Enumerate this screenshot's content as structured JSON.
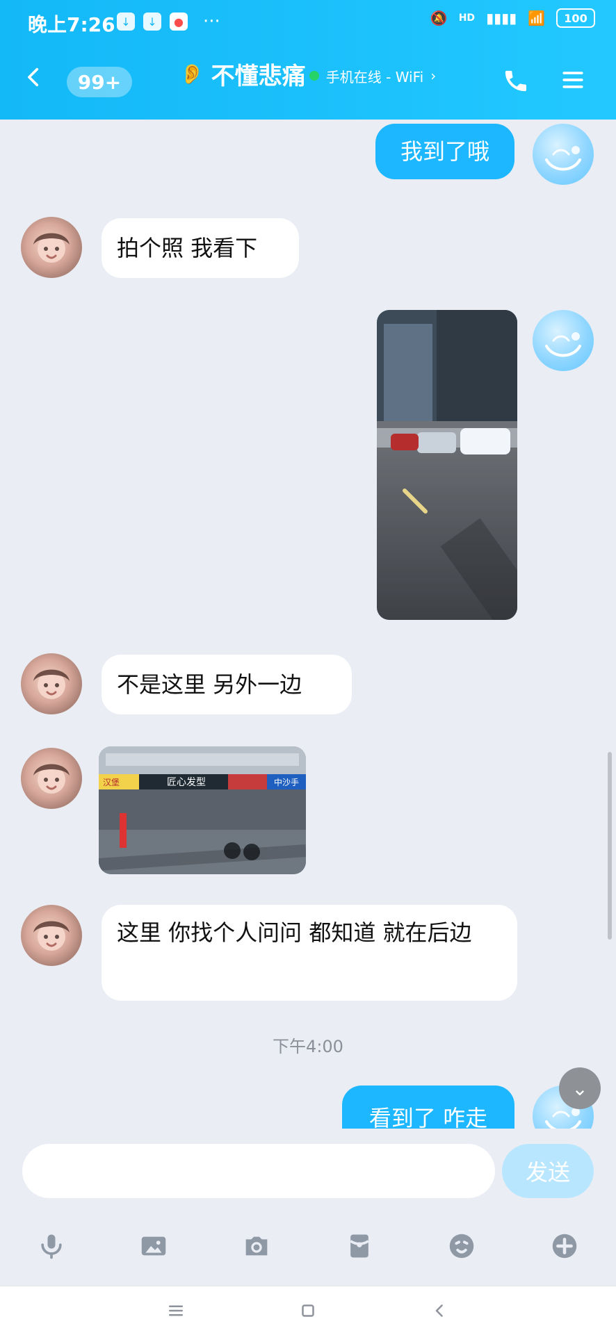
{
  "status_bar": {
    "time": "晚上7:26",
    "more": "···",
    "battery": "100",
    "hd": "HD"
  },
  "header": {
    "unread_badge": "99+",
    "contact_name": "不懂悲痛",
    "status": "手机在线 - WiFi"
  },
  "messages": [
    {
      "side": "me",
      "type": "text",
      "text": "我到了哦"
    },
    {
      "side": "other",
      "type": "text",
      "text": "拍个照 我看下"
    },
    {
      "side": "me",
      "type": "image"
    },
    {
      "side": "other",
      "type": "text",
      "text": "不是这里 另外一边"
    },
    {
      "side": "other",
      "type": "image",
      "sign_texts": [
        "汉堡",
        "匠心发型",
        "中沙手"
      ]
    },
    {
      "side": "other",
      "type": "text",
      "text": "这里 你找个人问问 都知道 就在后边"
    },
    {
      "type": "timestamp",
      "text": "下午4:00"
    },
    {
      "side": "me",
      "type": "text",
      "text": "看到了 咋走"
    }
  ],
  "input": {
    "placeholder": "",
    "value": "",
    "send_label": "发送"
  },
  "tools": [
    {
      "icon": "microphone-icon"
    },
    {
      "icon": "image-icon"
    },
    {
      "icon": "camera-icon"
    },
    {
      "icon": "red-packet-icon"
    },
    {
      "icon": "emoji-icon"
    },
    {
      "icon": "plus-icon"
    }
  ],
  "nav": [
    {
      "icon": "menu-icon"
    },
    {
      "icon": "home-icon"
    },
    {
      "icon": "back-icon"
    }
  ],
  "colors": {
    "header": "#13b8f7",
    "bubble_me": "#1cb7ff",
    "bubble_other": "#ffffff",
    "background": "#eaedf4",
    "send_disabled": "#b9e6ff"
  }
}
